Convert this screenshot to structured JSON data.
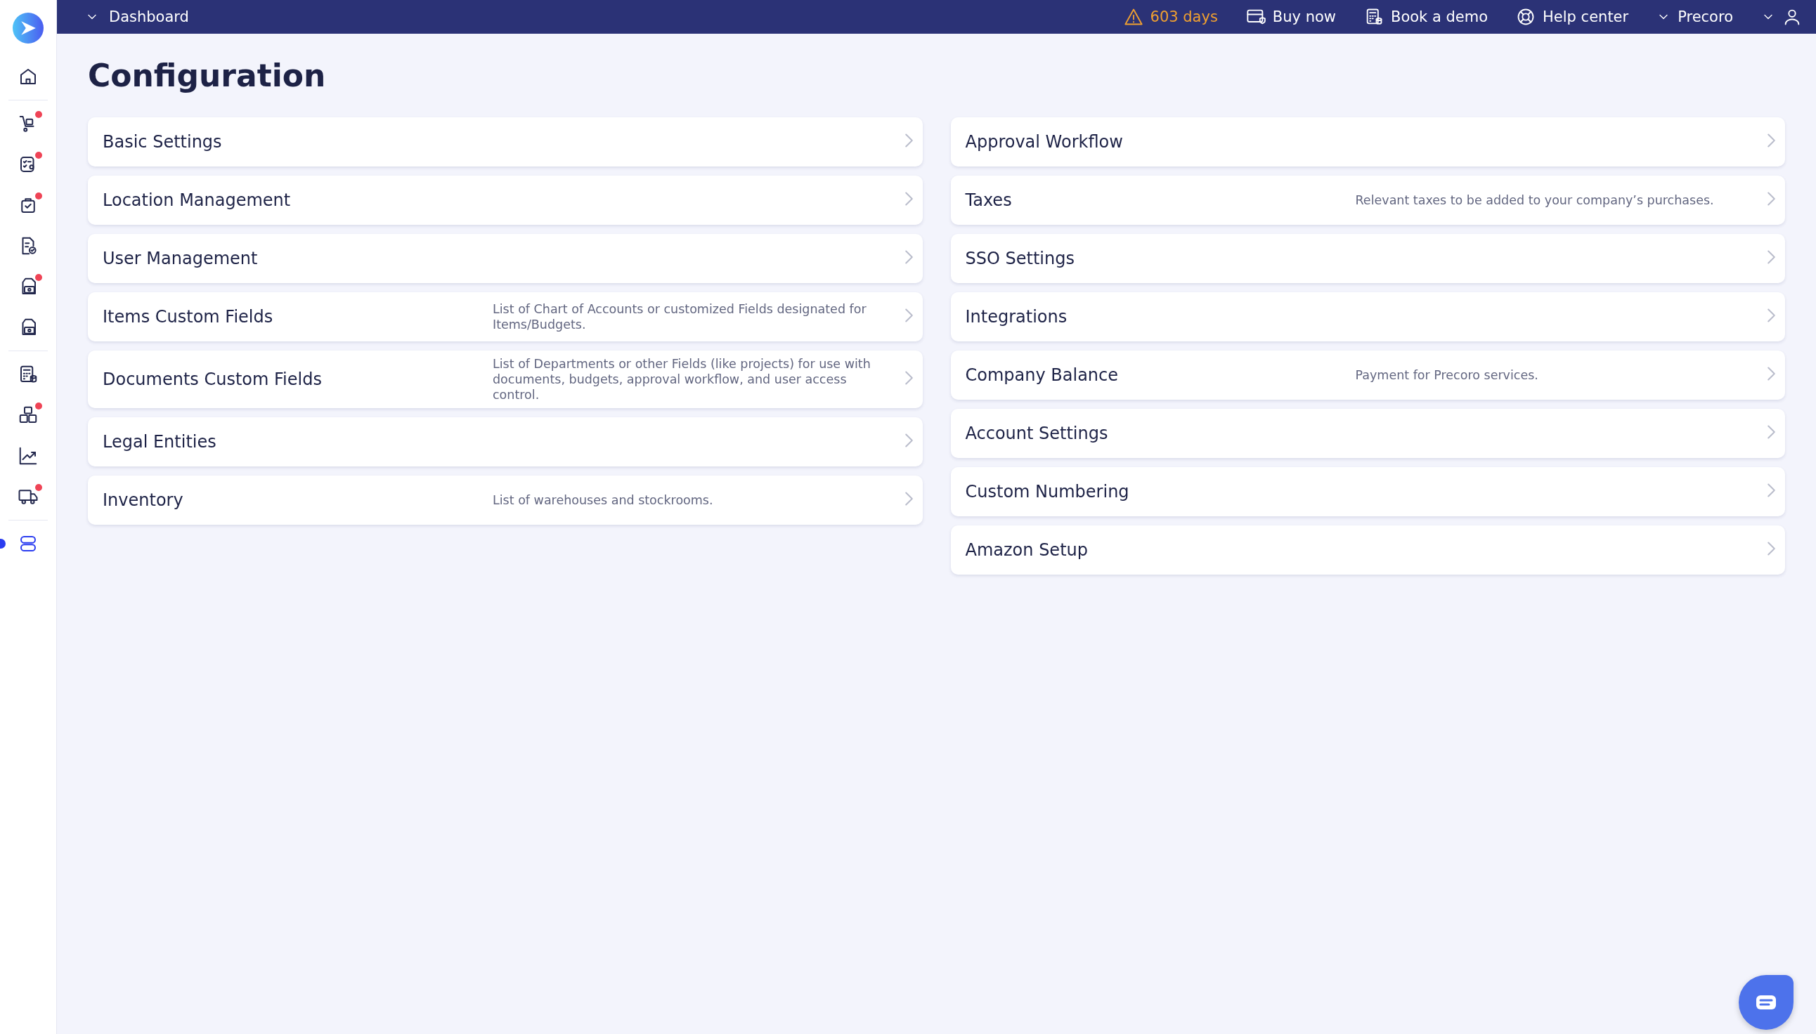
{
  "sidebar": {
    "groups": [
      [
        {
          "kind": "home",
          "notification": false,
          "selected": false
        }
      ],
      [
        {
          "kind": "cart",
          "notification": true,
          "selected": false
        },
        {
          "kind": "checklist",
          "notification": true,
          "selected": false
        },
        {
          "kind": "bag",
          "notification": true,
          "selected": false
        },
        {
          "kind": "doc-check",
          "notification": false,
          "selected": false
        },
        {
          "kind": "doc-money",
          "notification": true,
          "selected": false
        },
        {
          "kind": "doc-money",
          "notification": false,
          "selected": false
        }
      ],
      [
        {
          "kind": "calculator",
          "notification": false,
          "selected": false
        },
        {
          "kind": "boxes",
          "notification": true,
          "selected": false
        },
        {
          "kind": "chart",
          "notification": false,
          "selected": false
        },
        {
          "kind": "truck",
          "notification": true,
          "selected": false
        }
      ],
      [
        {
          "kind": "toggles",
          "notification": false,
          "selected": true
        }
      ]
    ]
  },
  "top_bar": {
    "menu": "Dashboard",
    "trial": "603 days",
    "links": [
      {
        "kind": "card",
        "label": "Buy now"
      },
      {
        "kind": "calculator",
        "label": "Book a demo"
      },
      {
        "kind": "lifebuoy",
        "label": "Help center"
      }
    ],
    "company": "Precoro"
  },
  "title": "Configuration",
  "columns": [
    [
      {
        "title": "Basic Settings"
      },
      {
        "title": "Location Management"
      },
      {
        "title": "User Management"
      },
      {
        "title": "Items Custom Fields",
        "description": "List of Chart of Accounts or customized Fields designated for Items/Budgets."
      },
      {
        "title": "Documents Custom Fields",
        "description": "List of Departments or other Fields (like projects) for use with documents, budgets, approval workflow, and user access control."
      },
      {
        "title": "Legal Entities"
      },
      {
        "title": "Inventory",
        "description": "List of warehouses and stockrooms."
      }
    ],
    [
      {
        "title": "Approval Workflow"
      },
      {
        "title": "Taxes",
        "description": "Relevant taxes to be added to your company’s purchases."
      },
      {
        "title": "SSO Settings"
      },
      {
        "title": "Integrations"
      },
      {
        "title": "Company Balance",
        "description": "Payment for Precoro services."
      },
      {
        "title": "Account Settings"
      },
      {
        "title": "Custom Numbering"
      },
      {
        "title": "Amazon Setup"
      }
    ]
  ]
}
